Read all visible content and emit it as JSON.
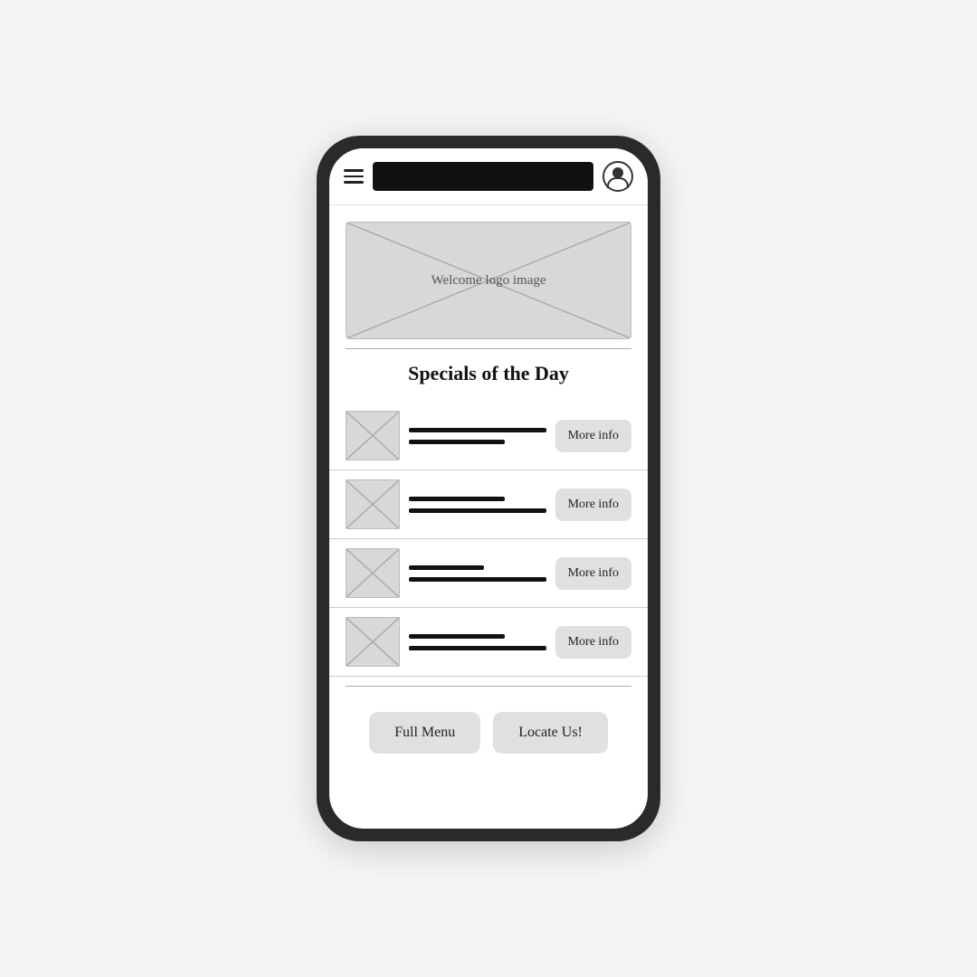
{
  "phone": {
    "header": {
      "logo_bar_label": "logo bar",
      "hamburger_label": "hamburger menu",
      "user_icon_label": "user profile icon"
    },
    "welcome_image": {
      "label": "Welcome logo image"
    },
    "section": {
      "title": "Specials of the Day"
    },
    "specials": [
      {
        "id": 1,
        "more_info_label": "More info"
      },
      {
        "id": 2,
        "more_info_label": "More info"
      },
      {
        "id": 3,
        "more_info_label": "More info"
      },
      {
        "id": 4,
        "more_info_label": "More info"
      }
    ],
    "bottom_buttons": {
      "full_menu_label": "Full Menu",
      "locate_us_label": "Locate Us!"
    }
  }
}
